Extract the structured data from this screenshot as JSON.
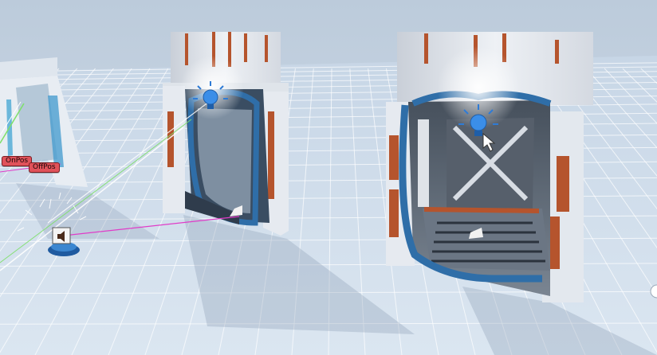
{
  "scene_view": {
    "gizmo_labels": {
      "on_pos": "OnPos",
      "off_pos": "OffPos"
    },
    "icons": [
      "light-bulb-icon",
      "camera-icon",
      "speaker-icon",
      "pointer-cursor-icon"
    ],
    "colors": {
      "sky": "#c9d6e3",
      "grid_floor": "#cfdcea",
      "grid_line": "#ffffff",
      "door_frame": "#e6eaf0",
      "door_accent": "#2f6ea8",
      "panel_orange": "#b5542d",
      "ray_magenta": "#e03cc8",
      "ray_green": "#7ee06a",
      "label_red": "#e0525a"
    }
  }
}
